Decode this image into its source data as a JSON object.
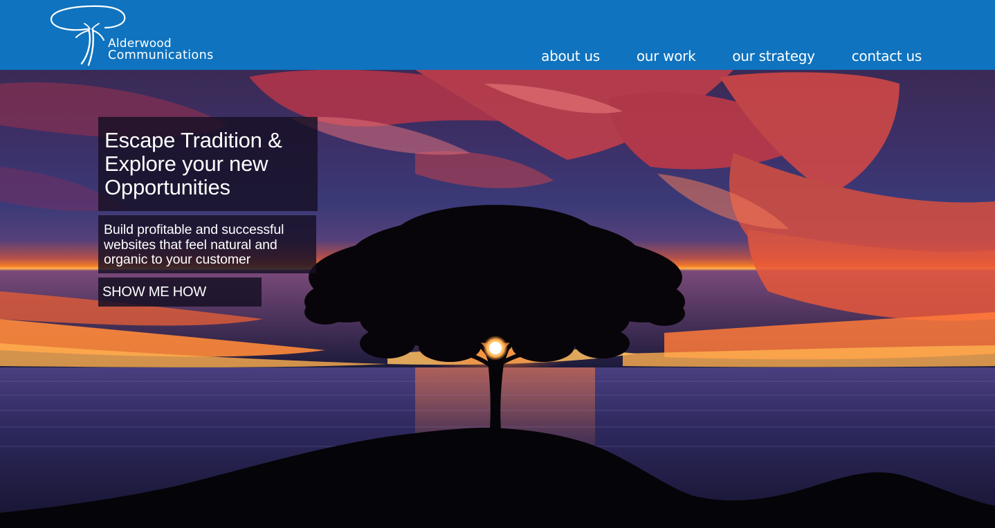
{
  "brand": {
    "name_line1": "Alderwood",
    "name_line2": "Communications"
  },
  "nav": {
    "items": [
      {
        "label": "about us"
      },
      {
        "label": "our work"
      },
      {
        "label": "our strategy"
      },
      {
        "label": "contact us"
      }
    ]
  },
  "hero": {
    "headline": "Escape Tradition & Explore your new Opportunities",
    "subtext": "Build profitable and successful websites that feel natural and organic to your customer",
    "cta_label": "SHOW ME HOW"
  },
  "colors": {
    "header": "#0f73bf",
    "text": "#ffffff",
    "overlay": "#161024"
  },
  "icons": {
    "logo": "tree-logo-icon"
  }
}
